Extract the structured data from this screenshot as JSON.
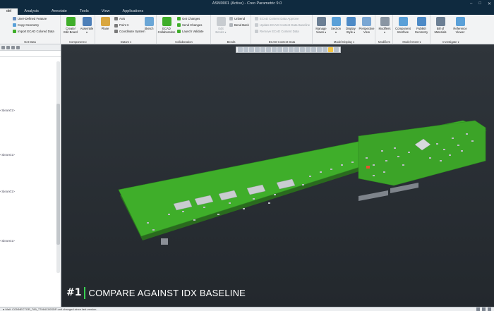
{
  "window": {
    "title": "ASM0001 (Active) - Creo Parametric 9.0",
    "min": "–",
    "max": "□",
    "close": "✕"
  },
  "tabs": [
    {
      "label": "del",
      "active": true
    },
    {
      "label": "Analysis"
    },
    {
      "label": "Annotate"
    },
    {
      "label": "Tools"
    },
    {
      "label": "View"
    },
    {
      "label": "Applications"
    }
  ],
  "ribbon": {
    "get_data": {
      "label": "Get Data",
      "items": [
        "User-Defined Feature",
        "Copy Geometry",
        "Import ECAD Colored Data"
      ]
    },
    "component": {
      "label": "Component ▾",
      "create": "Create/\nEdit Board",
      "assemble": "Assemble\n▾"
    },
    "datum": {
      "label": "Datum ▾",
      "plane": "Plane",
      "axis": "Axis",
      "point": "Point ▾",
      "csys": "Coordinate System",
      "sketch": "Sketch"
    },
    "collaboration": {
      "label": "Collaboration",
      "ecad": "ECAD\nCollaboration",
      "items": [
        "Get Changes",
        "Send Changes",
        "Launch Validate"
      ]
    },
    "bends": {
      "label": "Bends",
      "edit": "Edit\nBends ▾",
      "items": [
        "Unbend",
        "Bend Back"
      ]
    },
    "ecad_content": {
      "label": "ECAD Content Data",
      "items": [
        "ECAD Content Data Approve",
        "Update ECAD Content Data Baseline",
        "Remove ECAD Content Data"
      ]
    },
    "model_display": {
      "label": "Model Display ▾",
      "items": [
        "Manage\nViews ▾",
        "Section\n▾",
        "Display\nStyle ▾",
        "Perspective\nView"
      ]
    },
    "modifiers": {
      "label": "Modifiers",
      "item": "Modifiers\n▾"
    },
    "model_intent": {
      "label": "Model Intent ▾",
      "items": [
        "Component\nInterface",
        "Publish\nGeometry"
      ]
    },
    "investigate": {
      "label": "Investigate ▾",
      "items": [
        "Bill of\nMaterials",
        "Reference\nViewer"
      ]
    }
  },
  "left_panel": {
    "labels": [
      "<Idean01>",
      "<Idean01>",
      "<Idean01>",
      "<Idean01>"
    ]
  },
  "caption": {
    "number": "#1",
    "text": "COMPARE AGAINST IDX BASELINE"
  },
  "status": {
    "message": "● Mall: CONNECTOR_789_77064C00SDP unit changed since last version."
  },
  "colors": {
    "board": "#3fae2a",
    "accent": "#39d353",
    "background": "#2b3036"
  }
}
